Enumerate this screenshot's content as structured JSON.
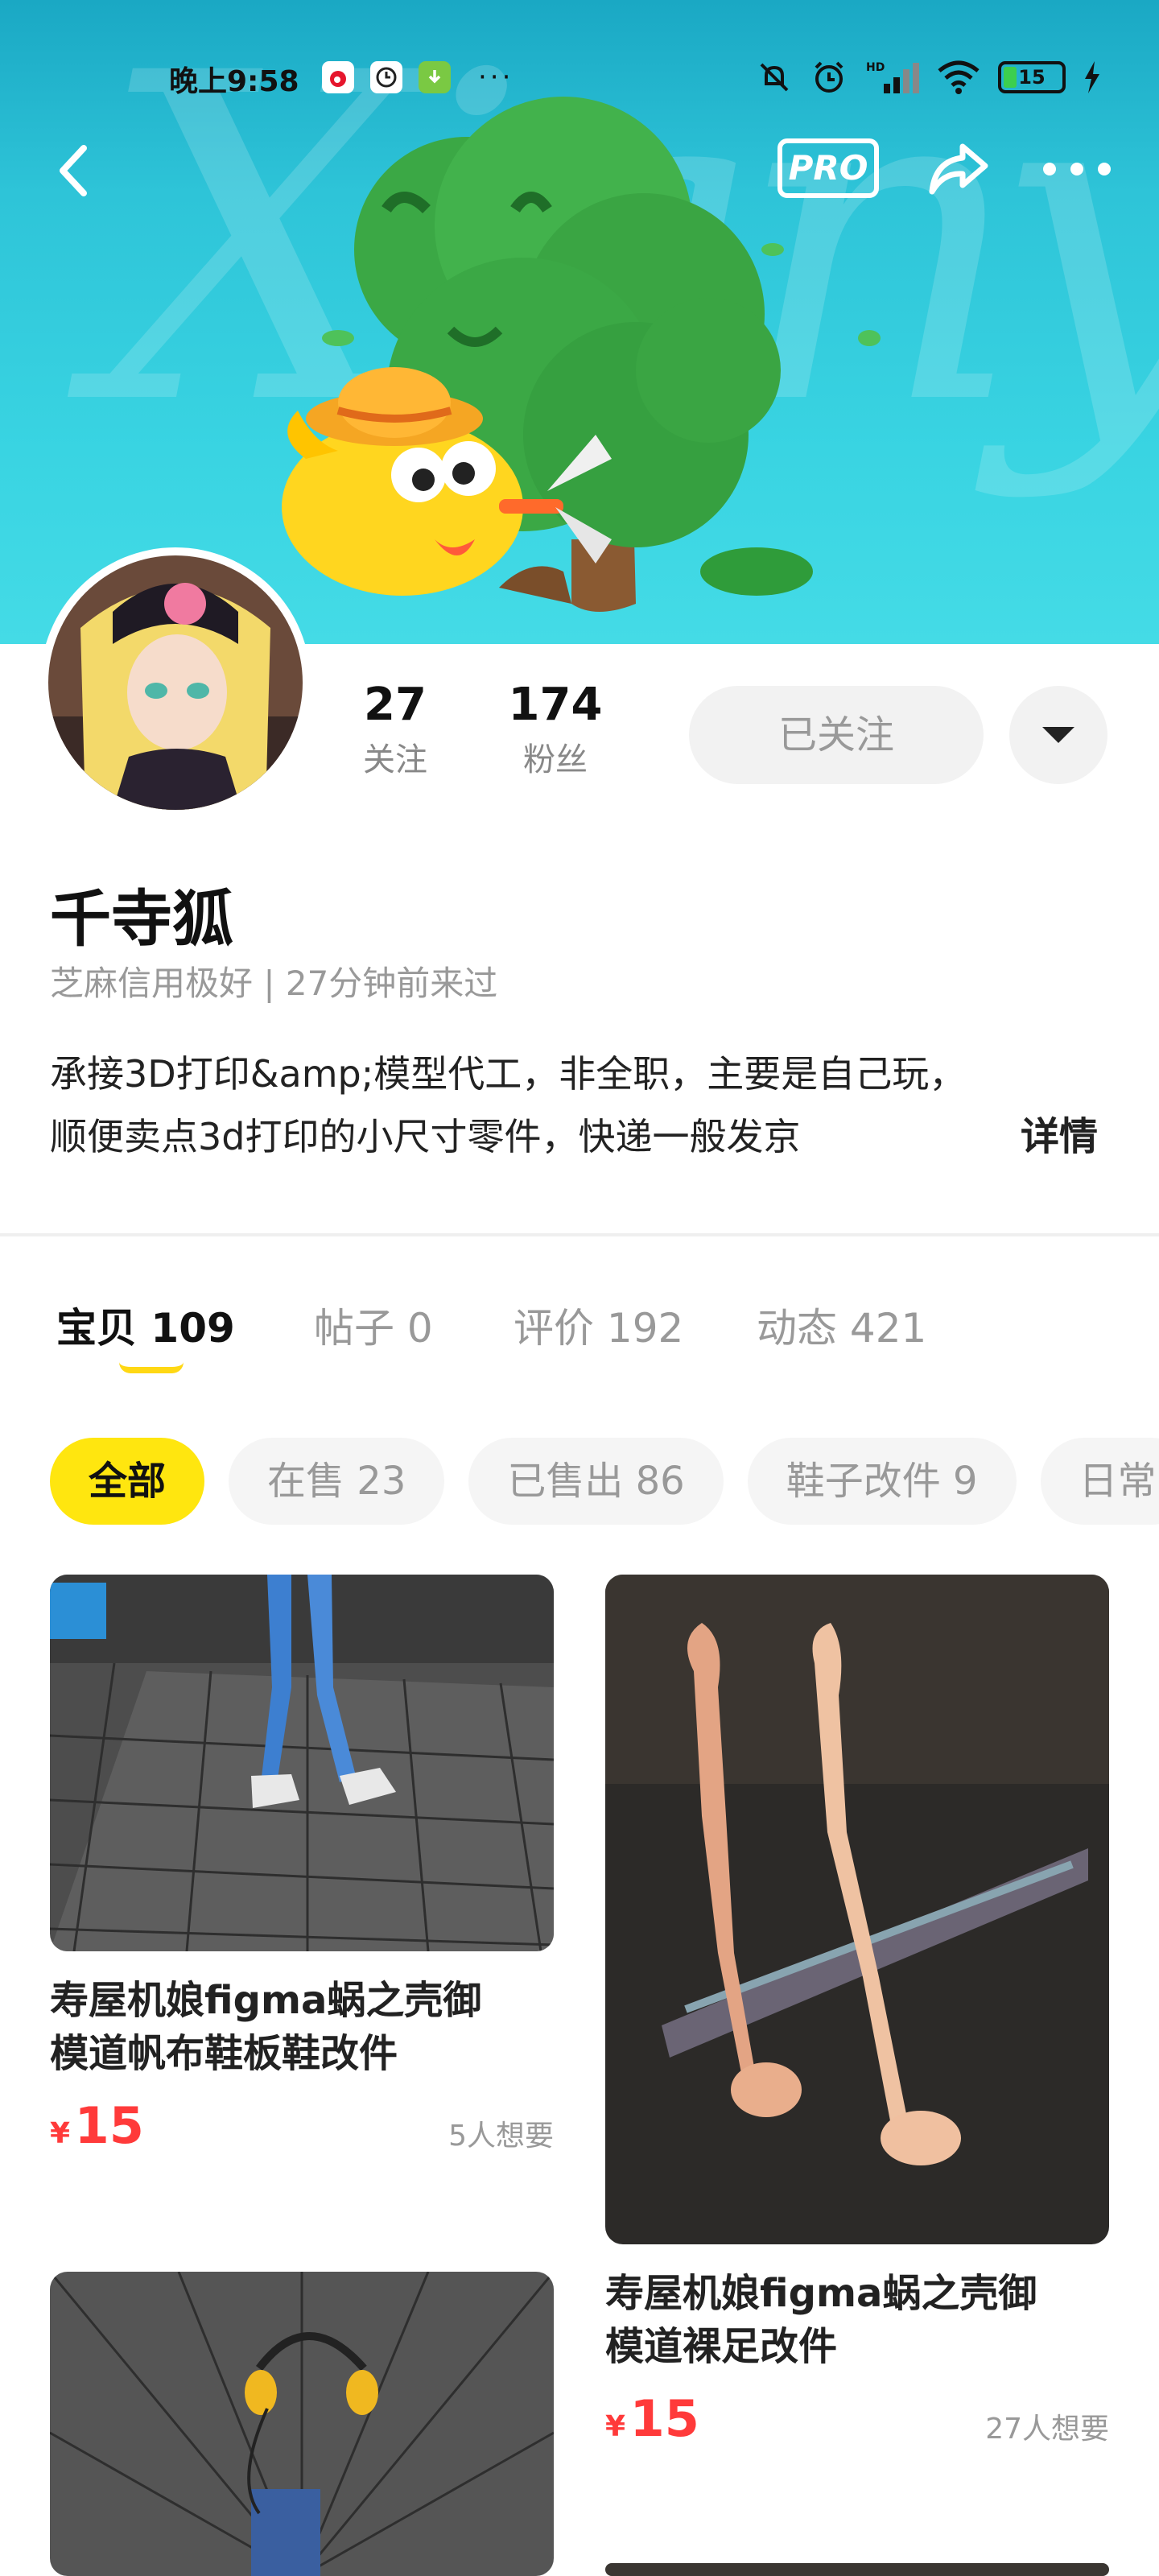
{
  "status_bar": {
    "time": "晚上9:58",
    "apps": [
      "weibo-app-icon",
      "clock-app-icon",
      "download-app-icon"
    ],
    "more_dots": "···",
    "battery": "15"
  },
  "nav": {
    "pro_label": "PRO"
  },
  "banner": {
    "watermark": "Xianyu"
  },
  "profile": {
    "following_count": "27",
    "following_label": "关注",
    "fans_count": "174",
    "fans_label": "粉丝",
    "follow_button": "已关注",
    "username": "千寺狐",
    "meta": "芝麻信用极好 | 27分钟前来过",
    "bio_line1": "承接3D打印&amp;模型代工，非全职，主要是自己玩，",
    "bio_line2": "顺便卖点3d打印的小尺寸零件，快递一般发京",
    "bio_more": "详情"
  },
  "tabs": [
    {
      "label": "宝贝",
      "count": "109",
      "active": true
    },
    {
      "label": "帖子",
      "count": "0"
    },
    {
      "label": "评价",
      "count": "192"
    },
    {
      "label": "动态",
      "count": "421"
    }
  ],
  "chips": [
    {
      "label": "全部",
      "active": true
    },
    {
      "label": "在售 23"
    },
    {
      "label": "已售出 86"
    },
    {
      "label": "鞋子改件 9"
    },
    {
      "label": "日常"
    }
  ],
  "products": [
    {
      "title_line1": "寿屋机娘figma蜗之壳御",
      "title_line2": "模道帆布鞋板鞋改件",
      "currency": "¥",
      "price": "15",
      "wants": "5人想要"
    },
    {
      "title_line1": "寿屋机娘figma蜗之壳御",
      "title_line2": "模道裸足改件",
      "currency": "¥",
      "price": "15",
      "wants": "27人想要"
    }
  ],
  "colors": {
    "accent_yellow": "#ffe60f",
    "price_red": "#ff3a3a",
    "banner_teal": "#39d4e2"
  }
}
